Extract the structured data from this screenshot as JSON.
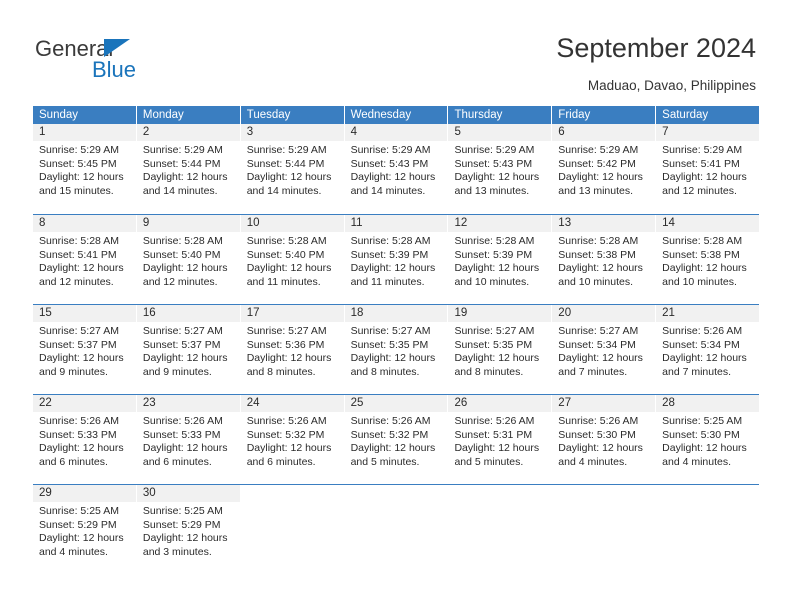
{
  "brand": {
    "name_dark": "General",
    "name_blue": "Blue",
    "accent_color": "#1a74bb"
  },
  "header": {
    "title": "September 2024",
    "location": "Maduao, Davao, Philippines"
  },
  "calendar": {
    "header_bg": "#3a7ec1",
    "daynum_bg": "#f1f1f1",
    "weekdays": [
      "Sunday",
      "Monday",
      "Tuesday",
      "Wednesday",
      "Thursday",
      "Friday",
      "Saturday"
    ],
    "weeks": [
      [
        {
          "day": "1",
          "sunrise": "Sunrise: 5:29 AM",
          "sunset": "Sunset: 5:45 PM",
          "daylight1": "Daylight: 12 hours",
          "daylight2": "and 15 minutes."
        },
        {
          "day": "2",
          "sunrise": "Sunrise: 5:29 AM",
          "sunset": "Sunset: 5:44 PM",
          "daylight1": "Daylight: 12 hours",
          "daylight2": "and 14 minutes."
        },
        {
          "day": "3",
          "sunrise": "Sunrise: 5:29 AM",
          "sunset": "Sunset: 5:44 PM",
          "daylight1": "Daylight: 12 hours",
          "daylight2": "and 14 minutes."
        },
        {
          "day": "4",
          "sunrise": "Sunrise: 5:29 AM",
          "sunset": "Sunset: 5:43 PM",
          "daylight1": "Daylight: 12 hours",
          "daylight2": "and 14 minutes."
        },
        {
          "day": "5",
          "sunrise": "Sunrise: 5:29 AM",
          "sunset": "Sunset: 5:43 PM",
          "daylight1": "Daylight: 12 hours",
          "daylight2": "and 13 minutes."
        },
        {
          "day": "6",
          "sunrise": "Sunrise: 5:29 AM",
          "sunset": "Sunset: 5:42 PM",
          "daylight1": "Daylight: 12 hours",
          "daylight2": "and 13 minutes."
        },
        {
          "day": "7",
          "sunrise": "Sunrise: 5:29 AM",
          "sunset": "Sunset: 5:41 PM",
          "daylight1": "Daylight: 12 hours",
          "daylight2": "and 12 minutes."
        }
      ],
      [
        {
          "day": "8",
          "sunrise": "Sunrise: 5:28 AM",
          "sunset": "Sunset: 5:41 PM",
          "daylight1": "Daylight: 12 hours",
          "daylight2": "and 12 minutes."
        },
        {
          "day": "9",
          "sunrise": "Sunrise: 5:28 AM",
          "sunset": "Sunset: 5:40 PM",
          "daylight1": "Daylight: 12 hours",
          "daylight2": "and 12 minutes."
        },
        {
          "day": "10",
          "sunrise": "Sunrise: 5:28 AM",
          "sunset": "Sunset: 5:40 PM",
          "daylight1": "Daylight: 12 hours",
          "daylight2": "and 11 minutes."
        },
        {
          "day": "11",
          "sunrise": "Sunrise: 5:28 AM",
          "sunset": "Sunset: 5:39 PM",
          "daylight1": "Daylight: 12 hours",
          "daylight2": "and 11 minutes."
        },
        {
          "day": "12",
          "sunrise": "Sunrise: 5:28 AM",
          "sunset": "Sunset: 5:39 PM",
          "daylight1": "Daylight: 12 hours",
          "daylight2": "and 10 minutes."
        },
        {
          "day": "13",
          "sunrise": "Sunrise: 5:28 AM",
          "sunset": "Sunset: 5:38 PM",
          "daylight1": "Daylight: 12 hours",
          "daylight2": "and 10 minutes."
        },
        {
          "day": "14",
          "sunrise": "Sunrise: 5:28 AM",
          "sunset": "Sunset: 5:38 PM",
          "daylight1": "Daylight: 12 hours",
          "daylight2": "and 10 minutes."
        }
      ],
      [
        {
          "day": "15",
          "sunrise": "Sunrise: 5:27 AM",
          "sunset": "Sunset: 5:37 PM",
          "daylight1": "Daylight: 12 hours",
          "daylight2": "and 9 minutes."
        },
        {
          "day": "16",
          "sunrise": "Sunrise: 5:27 AM",
          "sunset": "Sunset: 5:37 PM",
          "daylight1": "Daylight: 12 hours",
          "daylight2": "and 9 minutes."
        },
        {
          "day": "17",
          "sunrise": "Sunrise: 5:27 AM",
          "sunset": "Sunset: 5:36 PM",
          "daylight1": "Daylight: 12 hours",
          "daylight2": "and 8 minutes."
        },
        {
          "day": "18",
          "sunrise": "Sunrise: 5:27 AM",
          "sunset": "Sunset: 5:35 PM",
          "daylight1": "Daylight: 12 hours",
          "daylight2": "and 8 minutes."
        },
        {
          "day": "19",
          "sunrise": "Sunrise: 5:27 AM",
          "sunset": "Sunset: 5:35 PM",
          "daylight1": "Daylight: 12 hours",
          "daylight2": "and 8 minutes."
        },
        {
          "day": "20",
          "sunrise": "Sunrise: 5:27 AM",
          "sunset": "Sunset: 5:34 PM",
          "daylight1": "Daylight: 12 hours",
          "daylight2": "and 7 minutes."
        },
        {
          "day": "21",
          "sunrise": "Sunrise: 5:26 AM",
          "sunset": "Sunset: 5:34 PM",
          "daylight1": "Daylight: 12 hours",
          "daylight2": "and 7 minutes."
        }
      ],
      [
        {
          "day": "22",
          "sunrise": "Sunrise: 5:26 AM",
          "sunset": "Sunset: 5:33 PM",
          "daylight1": "Daylight: 12 hours",
          "daylight2": "and 6 minutes."
        },
        {
          "day": "23",
          "sunrise": "Sunrise: 5:26 AM",
          "sunset": "Sunset: 5:33 PM",
          "daylight1": "Daylight: 12 hours",
          "daylight2": "and 6 minutes."
        },
        {
          "day": "24",
          "sunrise": "Sunrise: 5:26 AM",
          "sunset": "Sunset: 5:32 PM",
          "daylight1": "Daylight: 12 hours",
          "daylight2": "and 6 minutes."
        },
        {
          "day": "25",
          "sunrise": "Sunrise: 5:26 AM",
          "sunset": "Sunset: 5:32 PM",
          "daylight1": "Daylight: 12 hours",
          "daylight2": "and 5 minutes."
        },
        {
          "day": "26",
          "sunrise": "Sunrise: 5:26 AM",
          "sunset": "Sunset: 5:31 PM",
          "daylight1": "Daylight: 12 hours",
          "daylight2": "and 5 minutes."
        },
        {
          "day": "27",
          "sunrise": "Sunrise: 5:26 AM",
          "sunset": "Sunset: 5:30 PM",
          "daylight1": "Daylight: 12 hours",
          "daylight2": "and 4 minutes."
        },
        {
          "day": "28",
          "sunrise": "Sunrise: 5:25 AM",
          "sunset": "Sunset: 5:30 PM",
          "daylight1": "Daylight: 12 hours",
          "daylight2": "and 4 minutes."
        }
      ],
      [
        {
          "day": "29",
          "sunrise": "Sunrise: 5:25 AM",
          "sunset": "Sunset: 5:29 PM",
          "daylight1": "Daylight: 12 hours",
          "daylight2": "and 4 minutes."
        },
        {
          "day": "30",
          "sunrise": "Sunrise: 5:25 AM",
          "sunset": "Sunset: 5:29 PM",
          "daylight1": "Daylight: 12 hours",
          "daylight2": "and 3 minutes."
        },
        {
          "day": "",
          "sunrise": "",
          "sunset": "",
          "daylight1": "",
          "daylight2": ""
        },
        {
          "day": "",
          "sunrise": "",
          "sunset": "",
          "daylight1": "",
          "daylight2": ""
        },
        {
          "day": "",
          "sunrise": "",
          "sunset": "",
          "daylight1": "",
          "daylight2": ""
        },
        {
          "day": "",
          "sunrise": "",
          "sunset": "",
          "daylight1": "",
          "daylight2": ""
        },
        {
          "day": "",
          "sunrise": "",
          "sunset": "",
          "daylight1": "",
          "daylight2": ""
        }
      ]
    ]
  }
}
